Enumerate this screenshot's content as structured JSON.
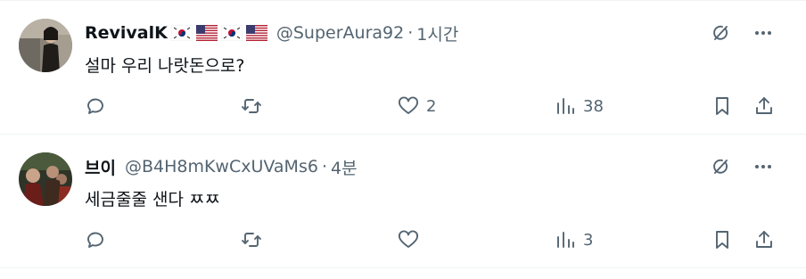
{
  "posts": [
    {
      "display_name": "RevivalK",
      "handle": "@SuperAura92",
      "time": "1시간",
      "text": "설마 우리 나랏돈으로?",
      "likes": "2",
      "views": "38",
      "flags": [
        "kr-flag",
        "us-flag",
        "kr-flag",
        "us-flag"
      ]
    },
    {
      "display_name": "브이",
      "handle": "@B4H8mKwCxUVaMs6",
      "time": "4분",
      "text": "세금줄줄 샌다 ㅉㅉ",
      "likes": "",
      "views": "3",
      "flags": []
    }
  ],
  "separator": "·",
  "colors": {
    "text": "#0f1419",
    "secondary": "#536471",
    "border": "#eff3f4"
  }
}
